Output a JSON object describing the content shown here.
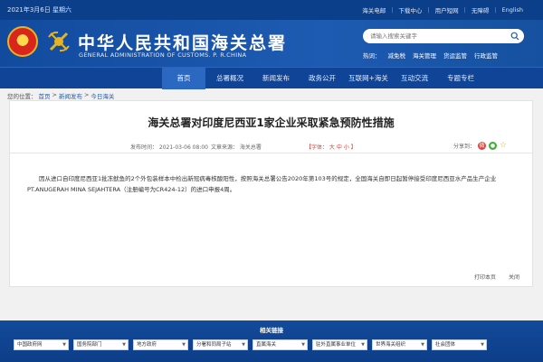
{
  "topbar": {
    "date": "2021年3月6日 星期六",
    "links": [
      "海关电邮",
      "下载中心",
      "用户短网",
      "无障碍",
      "English"
    ]
  },
  "header": {
    "title_cn": "中华人民共和国海关总署",
    "title_en": "GENERAL ADMINISTRATION OF CUSTOMS. P. R.CHINA",
    "search_placeholder": "请输入搜索关键字",
    "hot_label": "热词：",
    "hot_words": [
      "减免税",
      "海关管理",
      "货运监管",
      "行政监管"
    ]
  },
  "nav": {
    "items": [
      "首页",
      "总署概况",
      "新闻发布",
      "政务公开",
      "互联网+海关",
      "互动交流",
      "专题专栏"
    ],
    "active_index": 0
  },
  "breadcrumb": {
    "prefix": "您的位置：",
    "items": [
      "首页",
      "新闻发布",
      "今日海关"
    ],
    "separator": ">"
  },
  "article": {
    "title": "海关总署对印度尼西亚1家企业采取紧急预防性措施",
    "publish_time": "发布时间：  2021-03-06 08:00",
    "source": "文章来源：  海关总署",
    "font_size": "【字体： 大  中  小 】",
    "share_label": "分享到：",
    "body": "因从进口自印度尼西亚1批冻鱿鱼的2个外包装样本中检出新冠病毒核酸阳性，按照海关总署公告2020年第103号的规定，全国海关自即日起暂停接受印度尼西亚水产品生产企业PT.ANUGERAH MINA SEJAHTERA（注册编号为CR424-12）的进口申报4周。",
    "print": "打印本页",
    "close": "关闭"
  },
  "footer": {
    "title": "相关链接",
    "selects": [
      "中国政府网",
      "国务院部门",
      "地方政府",
      "分署和同局子站",
      "直属海关",
      "驻外直属事业单位",
      "世界海关组织",
      "社会团体"
    ]
  },
  "colors": {
    "primary": "#0f4497",
    "accent_red": "#d1413b"
  }
}
